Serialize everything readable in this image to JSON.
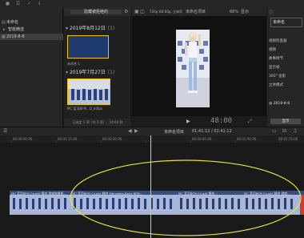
{
  "colors": {
    "accent_yellow": "#f0c400",
    "timecode_orange": "#e8a23c",
    "storyline_blue": "#3a4c7a",
    "clip_blue": "#5b6fa3",
    "annotation_ellipse": "#e6e23a",
    "selection_red": "#e0352b"
  },
  "toolbar": {
    "icons": [
      "mic-icon",
      "key-icon",
      "check-icon",
      "import-icon"
    ]
  },
  "sidebar": {
    "items": [
      {
        "label": "未命名",
        "icon": "library-icon"
      },
      {
        "label": "智能精选",
        "icon": "folder-icon"
      },
      {
        "label": "2019-8-8",
        "icon": "calendar-icon",
        "selected": true
      }
    ]
  },
  "browser": {
    "filter_label": "隐藏被拒绝的",
    "groups": [
      {
        "date": "2019年8月12日",
        "count": "(1)",
        "clip_label": "未命名-1"
      },
      {
        "date": "2019年7月27日",
        "count": "(1)",
        "clip_label": "MC 蓝羽BFM...D_60fps"
      }
    ],
    "footer": "已选定 1 项（共 2 项），14:03 秒"
  },
  "viewer": {
    "format": "720p HD 60p, 立体声",
    "title": "未命名项目",
    "zoom": "66%",
    "view_label": "显示",
    "timecode": "48:00"
  },
  "inspector": {
    "title": "未命名",
    "rows": [
      "视频检查器",
      "视频",
      "故事情节",
      "显示帧",
      "360° 投影",
      "立体模式"
    ],
    "date": "2019-8-8",
    "button": "显示"
  },
  "timeline": {
    "project": "未命名项目",
    "timecode": "01:41:12 / 01:41:12",
    "ticks": [
      "00:00:00:00",
      "00:00:15:00",
      "00:00:30:00",
      "00:00:45:00",
      "00:01:00:00",
      "00:01:15:00"
    ],
    "clips": [
      {
        "title": "MC 蓝羽BFM Crush] 睡衣 游戏结果版..."
      },
      {
        "title": "MC 蓝羽BFM Crush] 睡衣 Mercedes-Benz BFM..."
      },
      {
        "title": "MC 蓝羽BFM Crush] 睡衣..."
      },
      {
        "title": "MC 蓝羽BFM Crush] 睡衣 游戏..."
      }
    ]
  }
}
